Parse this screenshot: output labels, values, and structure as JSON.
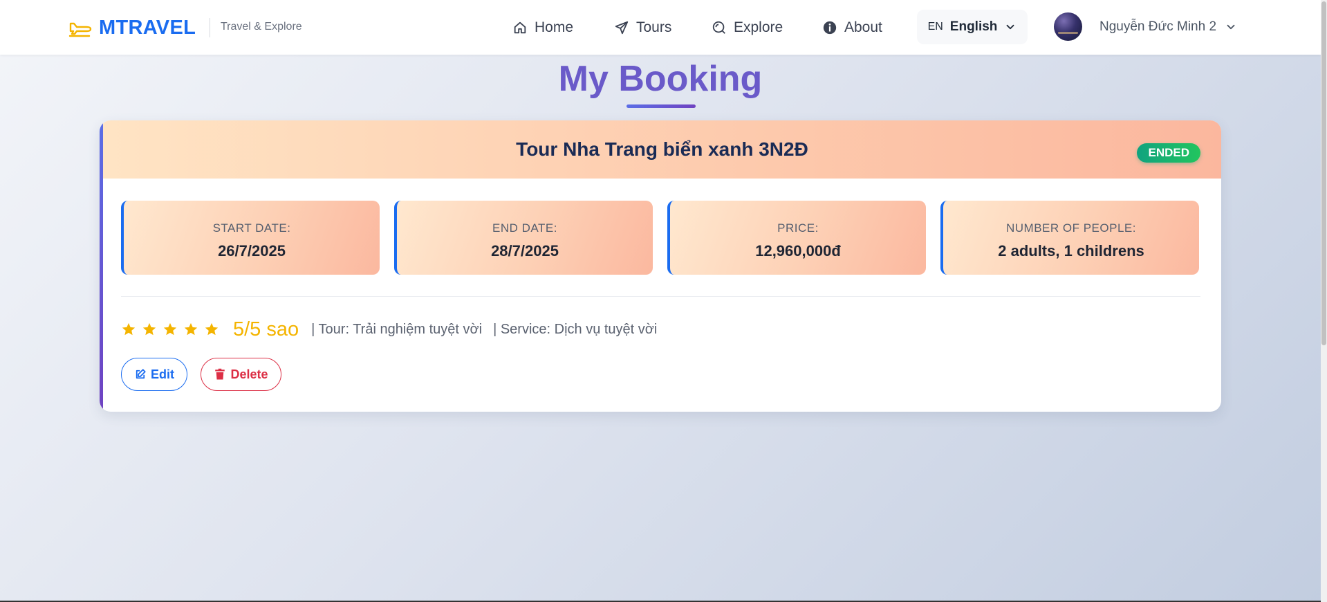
{
  "brand": {
    "name": "MTRAVEL",
    "tagline": "Travel & Explore",
    "logo_icon": "plane-icon",
    "color": "#1a6cf0"
  },
  "nav": {
    "items": [
      {
        "label": "Home",
        "icon": "home-icon"
      },
      {
        "label": "Tours",
        "icon": "paper-plane-icon"
      },
      {
        "label": "Explore",
        "icon": "explore-icon"
      },
      {
        "label": "About",
        "icon": "info-icon"
      }
    ]
  },
  "language": {
    "code": "EN",
    "name": "English"
  },
  "user": {
    "name": "Nguyễn Đức Minh 2"
  },
  "page": {
    "title": "My Booking",
    "title_color": "#6a5ac9"
  },
  "booking": {
    "tour_name": "Tour Nha Trang biển xanh 3N2Đ",
    "status": "ENDED",
    "status_color": "#10a37f",
    "details": [
      {
        "label": "START DATE:",
        "value": "26/7/2025"
      },
      {
        "label": "END DATE:",
        "value": "28/7/2025"
      },
      {
        "label": "PRICE:",
        "value": "12,960,000đ"
      },
      {
        "label": "NUMBER OF PEOPLE:",
        "value": "2 adults, 1 childrens"
      }
    ],
    "rating": {
      "stars": 5,
      "max_stars": 5,
      "score_text": "5/5 sao",
      "tour_review": "| Tour: Trải nghiệm tuyệt vời",
      "service_review": "| Service: Dịch vụ tuyệt vời",
      "star_color": "#f4b400"
    },
    "actions": {
      "edit_label": "Edit",
      "delete_label": "Delete"
    }
  }
}
